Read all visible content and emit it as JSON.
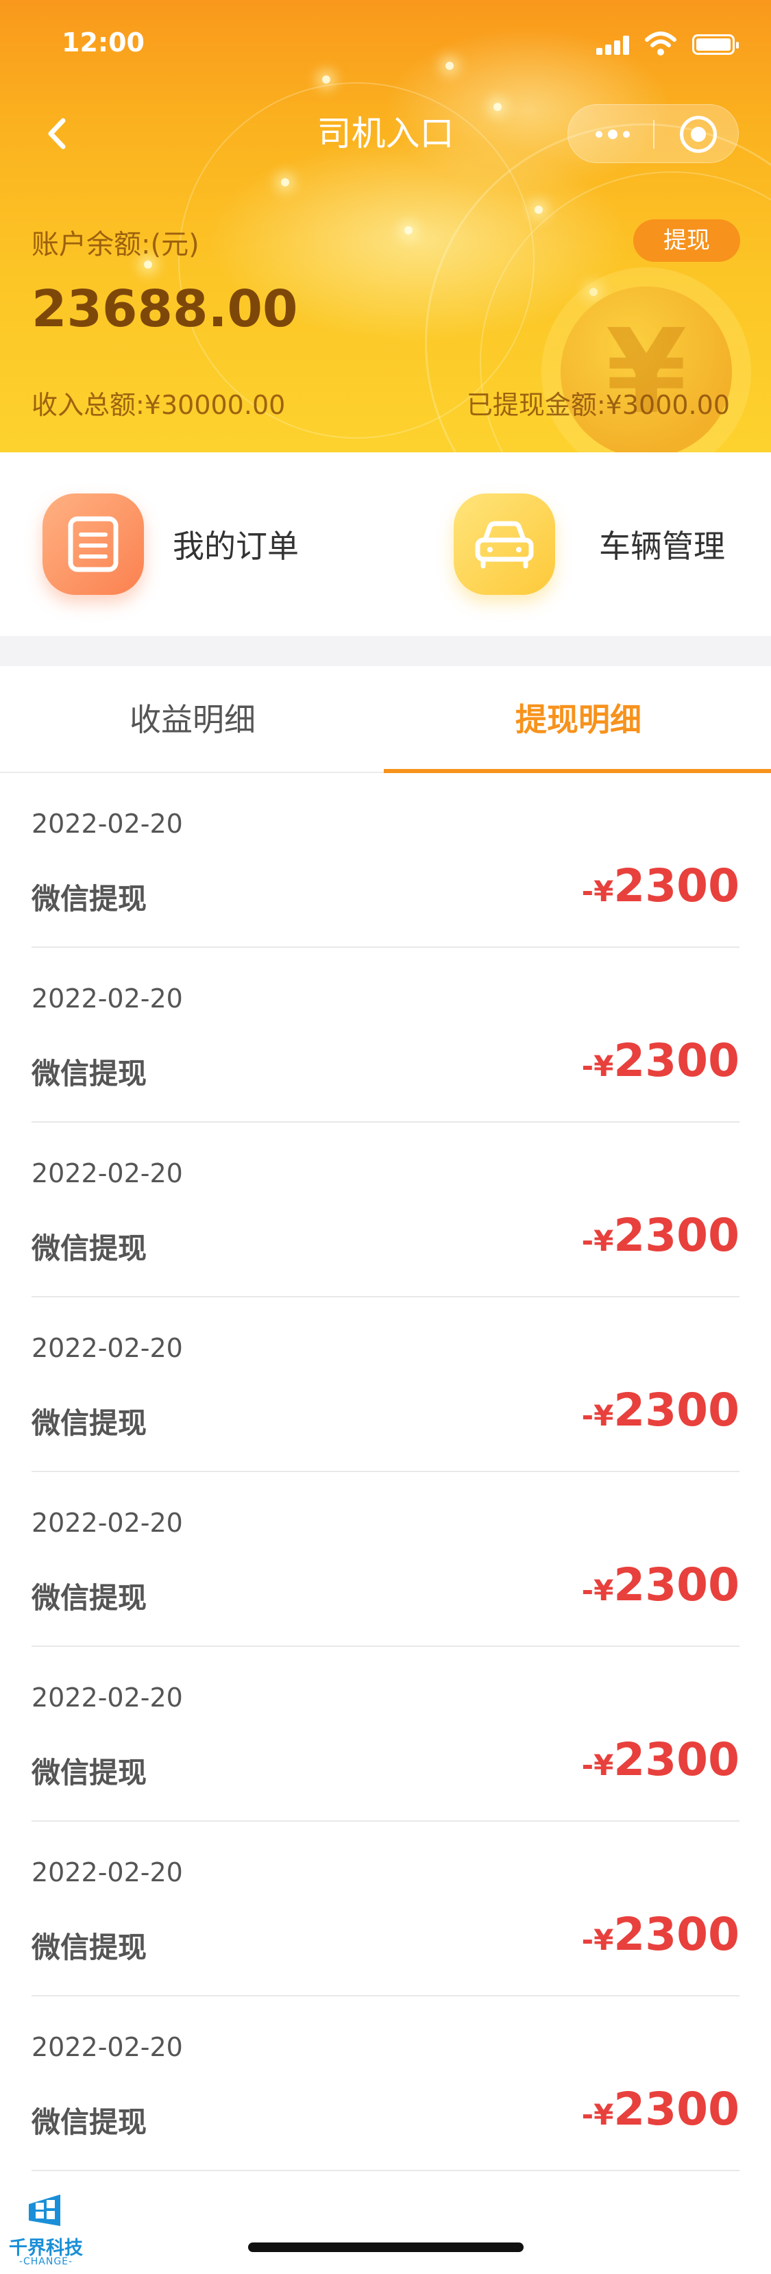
{
  "status_bar": {
    "time": "12:00"
  },
  "nav": {
    "title": "司机入口"
  },
  "account": {
    "balance_label": "账户余额:(元)",
    "balance": "23688.00",
    "withdraw_button": "提现",
    "total_income": "收入总额:¥30000.00",
    "withdrawn_total": "已提现金额:¥3000.00",
    "coin_symbol": "¥"
  },
  "quick_entries": {
    "orders_label": "我的订单",
    "vehicles_label": "车辆管理"
  },
  "tabs": {
    "income_label": "收益明细",
    "withdraw_label": "提现明细",
    "active": "withdraw"
  },
  "records": [
    {
      "date": "2022-02-20",
      "method": "微信提现",
      "prefix": "-¥",
      "amount": "2300"
    },
    {
      "date": "2022-02-20",
      "method": "微信提现",
      "prefix": "-¥",
      "amount": "2300"
    },
    {
      "date": "2022-02-20",
      "method": "微信提现",
      "prefix": "-¥",
      "amount": "2300"
    },
    {
      "date": "2022-02-20",
      "method": "微信提现",
      "prefix": "-¥",
      "amount": "2300"
    },
    {
      "date": "2022-02-20",
      "method": "微信提现",
      "prefix": "-¥",
      "amount": "2300"
    },
    {
      "date": "2022-02-20",
      "method": "微信提现",
      "prefix": "-¥",
      "amount": "2300"
    },
    {
      "date": "2022-02-20",
      "method": "微信提现",
      "prefix": "-¥",
      "amount": "2300"
    },
    {
      "date": "2022-02-20",
      "method": "微信提现",
      "prefix": "-¥",
      "amount": "2300"
    }
  ],
  "watermark": {
    "name": "千界科技",
    "sub": "-CHANGE-"
  },
  "colors": {
    "accent": "#f7921c",
    "amount": "#e8403c",
    "header_top": "#f9981c",
    "header_bottom": "#fdd22e"
  },
  "icons": {
    "back": "chevron-left-icon",
    "more": "more-dots-icon",
    "close": "target-circle-icon",
    "orders": "document-list-icon",
    "vehicles": "car-icon"
  }
}
